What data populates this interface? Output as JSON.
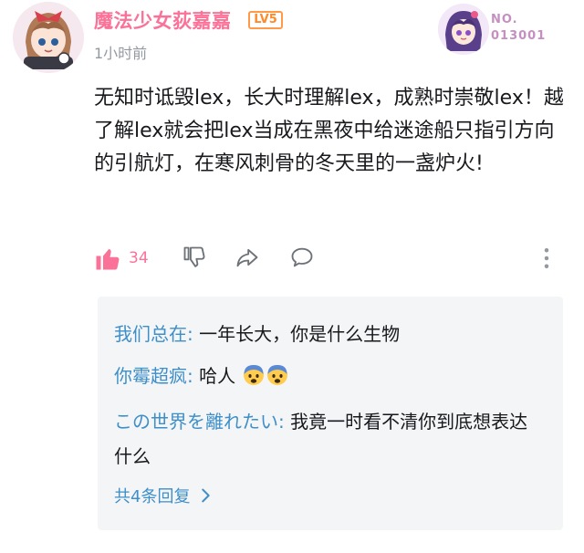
{
  "comment": {
    "username": "魔法少女荻嘉嘉",
    "level": "LV5",
    "time": "1小时前",
    "content": "无知时诋毁lex，长大时理解lex，成熟时崇敬lex！越了解lex就会把lex当成在黑夜中给迷途船只指引方向的引航灯，在寒风刺骨的冬天里的一盏炉火!",
    "likes": "34"
  },
  "fan_badge": {
    "label": "NO.",
    "number": "013001"
  },
  "replies": [
    {
      "name": "我们总在:",
      "text": " 一年长大，你是什么生物"
    },
    {
      "name": "你霉超疯:",
      "text": " 哈人",
      "emoji_count": 2
    },
    {
      "name": "この世界を離れたい:",
      "text": " 我竟一时看不清你到底想表达什么"
    }
  ],
  "more_replies": "共4条回复",
  "icons": {
    "like": "thumbs-up-icon",
    "dislike": "thumbs-down-icon",
    "share": "share-arrow-icon",
    "reply": "comment-bubble-icon",
    "more": "vertical-dots-icon",
    "emoji": "fearful-face-emoji",
    "chevron": "chevron-right-icon"
  },
  "colors": {
    "accent_pink": "#fb7299",
    "link_blue": "#3e8fc8",
    "level_orange": "#ff8a2a",
    "meta_gray": "#9499a0"
  }
}
